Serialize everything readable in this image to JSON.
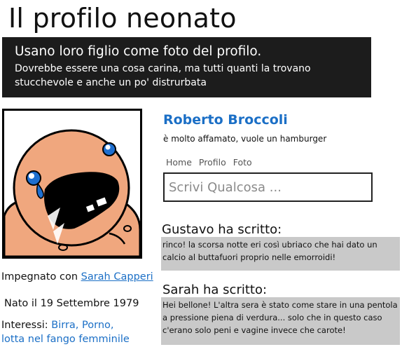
{
  "header": {
    "title": "Il profilo neonato",
    "banner_heading": "Usano loro figlio come foto del profilo.",
    "banner_text": "Dovrebbe essere una cosa carina, ma tutti quanti la trovano stucchevole e anche un po' distrurbata"
  },
  "profile": {
    "name": "Roberto Broccoli",
    "status": "è molto affamato, vuole un hamburger",
    "nav": [
      "Home",
      "Profilo",
      "Foto"
    ],
    "composer_placeholder": "Scrivi Qualcosa ...",
    "relationship_label": "Impegnato con",
    "relationship_partner": "Sarah Capperi",
    "birth": "Nato il 19 Settembre 1979",
    "interests_label": "Interessi:",
    "interests_line1": "Birra, Porno,",
    "interests_line2": "lotta nel fango femminile"
  },
  "posts": [
    {
      "author": "Gustavo ha scritto:",
      "text": "rinco! la scorsa notte eri così ubriaco che hai dato un calcio al buttafuori proprio nelle emorroidi!"
    },
    {
      "author": "Sarah ha scritto:",
      "text": "Hei bellone! L'altra sera è stato come stare in una pentola a pressione piena di verdura... solo che in questo caso c'erano solo peni e vagine invece che carote!"
    }
  ],
  "colors": {
    "link": "#1b6fc6",
    "banner_bg": "#1c1c1c",
    "post_bg": "#c9c9c9",
    "skin": "#f0a77e"
  },
  "icons": {
    "photo": "crying-baby-avatar"
  }
}
